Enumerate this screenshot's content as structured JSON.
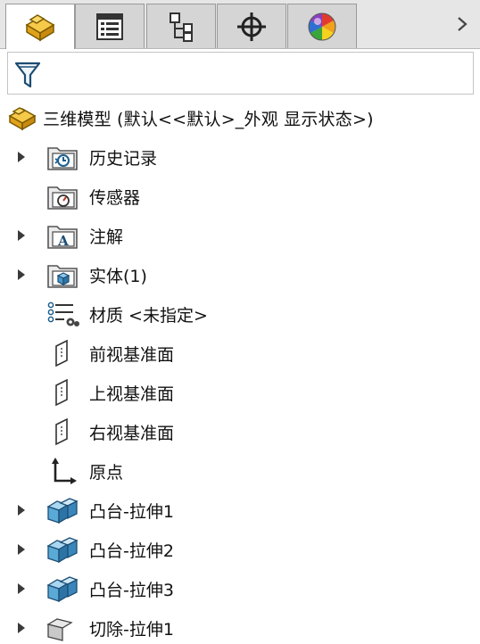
{
  "tabs": [
    {
      "icon": "feature-manager-icon",
      "active": true
    },
    {
      "icon": "property-manager-icon",
      "active": false
    },
    {
      "icon": "configuration-manager-icon",
      "active": false
    },
    {
      "icon": "dimxpert-manager-icon",
      "active": false
    },
    {
      "icon": "display-manager-icon",
      "active": false
    }
  ],
  "filter": {
    "icon": "filter-icon"
  },
  "tree": {
    "root_label": "三维模型  (默认<<默认>_外观 显示状态>)",
    "nodes": [
      {
        "label": "历史记录",
        "icon": "history-folder-icon",
        "expandable": true
      },
      {
        "label": "传感器",
        "icon": "sensor-folder-icon",
        "expandable": false
      },
      {
        "label": "注解",
        "icon": "annotation-folder-icon",
        "expandable": true
      },
      {
        "label": "实体(1)",
        "icon": "solid-body-folder-icon",
        "expandable": true
      },
      {
        "label": "材质 <未指定>",
        "icon": "material-icon",
        "expandable": false
      },
      {
        "label": "前视基准面",
        "icon": "plane-icon",
        "expandable": false
      },
      {
        "label": "上视基准面",
        "icon": "plane-icon",
        "expandable": false
      },
      {
        "label": "右视基准面",
        "icon": "plane-icon",
        "expandable": false
      },
      {
        "label": "原点",
        "icon": "origin-icon",
        "expandable": false
      },
      {
        "label": "凸台-拉伸1",
        "icon": "boss-extrude-icon",
        "expandable": true
      },
      {
        "label": "凸台-拉伸2",
        "icon": "boss-extrude-icon",
        "expandable": true
      },
      {
        "label": "凸台-拉伸3",
        "icon": "boss-extrude-icon",
        "expandable": true
      },
      {
        "label": "切除-拉伸1",
        "icon": "cut-extrude-icon",
        "expandable": true
      }
    ]
  },
  "colors": {
    "accent": "#f2b52c",
    "boss": "#5aa9d6",
    "panel": "#e6e6e6"
  }
}
